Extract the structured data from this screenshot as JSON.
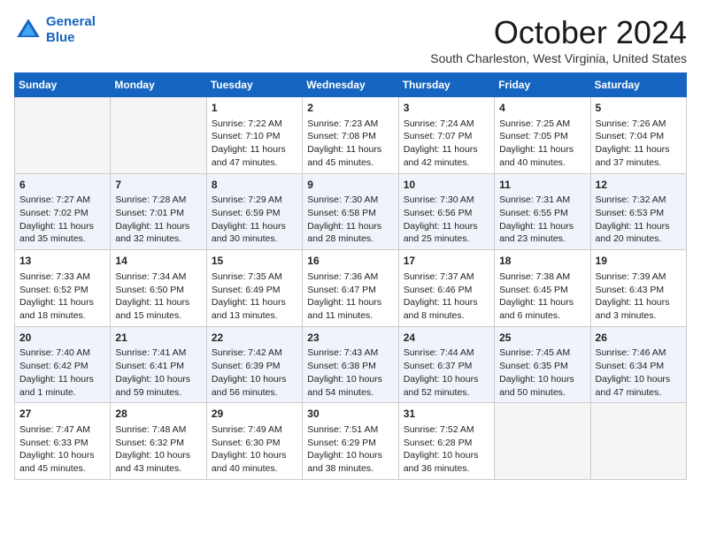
{
  "logo": {
    "line1": "General",
    "line2": "Blue"
  },
  "title": "October 2024",
  "subtitle": "South Charleston, West Virginia, United States",
  "days_of_week": [
    "Sunday",
    "Monday",
    "Tuesday",
    "Wednesday",
    "Thursday",
    "Friday",
    "Saturday"
  ],
  "weeks": [
    [
      {
        "day": "",
        "empty": true
      },
      {
        "day": "",
        "empty": true
      },
      {
        "day": "1",
        "lines": [
          "Sunrise: 7:22 AM",
          "Sunset: 7:10 PM",
          "Daylight: 11 hours and 47 minutes."
        ]
      },
      {
        "day": "2",
        "lines": [
          "Sunrise: 7:23 AM",
          "Sunset: 7:08 PM",
          "Daylight: 11 hours and 45 minutes."
        ]
      },
      {
        "day": "3",
        "lines": [
          "Sunrise: 7:24 AM",
          "Sunset: 7:07 PM",
          "Daylight: 11 hours and 42 minutes."
        ]
      },
      {
        "day": "4",
        "lines": [
          "Sunrise: 7:25 AM",
          "Sunset: 7:05 PM",
          "Daylight: 11 hours and 40 minutes."
        ]
      },
      {
        "day": "5",
        "lines": [
          "Sunrise: 7:26 AM",
          "Sunset: 7:04 PM",
          "Daylight: 11 hours and 37 minutes."
        ]
      }
    ],
    [
      {
        "day": "6",
        "lines": [
          "Sunrise: 7:27 AM",
          "Sunset: 7:02 PM",
          "Daylight: 11 hours and 35 minutes."
        ]
      },
      {
        "day": "7",
        "lines": [
          "Sunrise: 7:28 AM",
          "Sunset: 7:01 PM",
          "Daylight: 11 hours and 32 minutes."
        ]
      },
      {
        "day": "8",
        "lines": [
          "Sunrise: 7:29 AM",
          "Sunset: 6:59 PM",
          "Daylight: 11 hours and 30 minutes."
        ]
      },
      {
        "day": "9",
        "lines": [
          "Sunrise: 7:30 AM",
          "Sunset: 6:58 PM",
          "Daylight: 11 hours and 28 minutes."
        ]
      },
      {
        "day": "10",
        "lines": [
          "Sunrise: 7:30 AM",
          "Sunset: 6:56 PM",
          "Daylight: 11 hours and 25 minutes."
        ]
      },
      {
        "day": "11",
        "lines": [
          "Sunrise: 7:31 AM",
          "Sunset: 6:55 PM",
          "Daylight: 11 hours and 23 minutes."
        ]
      },
      {
        "day": "12",
        "lines": [
          "Sunrise: 7:32 AM",
          "Sunset: 6:53 PM",
          "Daylight: 11 hours and 20 minutes."
        ]
      }
    ],
    [
      {
        "day": "13",
        "lines": [
          "Sunrise: 7:33 AM",
          "Sunset: 6:52 PM",
          "Daylight: 11 hours and 18 minutes."
        ]
      },
      {
        "day": "14",
        "lines": [
          "Sunrise: 7:34 AM",
          "Sunset: 6:50 PM",
          "Daylight: 11 hours and 15 minutes."
        ]
      },
      {
        "day": "15",
        "lines": [
          "Sunrise: 7:35 AM",
          "Sunset: 6:49 PM",
          "Daylight: 11 hours and 13 minutes."
        ]
      },
      {
        "day": "16",
        "lines": [
          "Sunrise: 7:36 AM",
          "Sunset: 6:47 PM",
          "Daylight: 11 hours and 11 minutes."
        ]
      },
      {
        "day": "17",
        "lines": [
          "Sunrise: 7:37 AM",
          "Sunset: 6:46 PM",
          "Daylight: 11 hours and 8 minutes."
        ]
      },
      {
        "day": "18",
        "lines": [
          "Sunrise: 7:38 AM",
          "Sunset: 6:45 PM",
          "Daylight: 11 hours and 6 minutes."
        ]
      },
      {
        "day": "19",
        "lines": [
          "Sunrise: 7:39 AM",
          "Sunset: 6:43 PM",
          "Daylight: 11 hours and 3 minutes."
        ]
      }
    ],
    [
      {
        "day": "20",
        "lines": [
          "Sunrise: 7:40 AM",
          "Sunset: 6:42 PM",
          "Daylight: 11 hours and 1 minute."
        ]
      },
      {
        "day": "21",
        "lines": [
          "Sunrise: 7:41 AM",
          "Sunset: 6:41 PM",
          "Daylight: 10 hours and 59 minutes."
        ]
      },
      {
        "day": "22",
        "lines": [
          "Sunrise: 7:42 AM",
          "Sunset: 6:39 PM",
          "Daylight: 10 hours and 56 minutes."
        ]
      },
      {
        "day": "23",
        "lines": [
          "Sunrise: 7:43 AM",
          "Sunset: 6:38 PM",
          "Daylight: 10 hours and 54 minutes."
        ]
      },
      {
        "day": "24",
        "lines": [
          "Sunrise: 7:44 AM",
          "Sunset: 6:37 PM",
          "Daylight: 10 hours and 52 minutes."
        ]
      },
      {
        "day": "25",
        "lines": [
          "Sunrise: 7:45 AM",
          "Sunset: 6:35 PM",
          "Daylight: 10 hours and 50 minutes."
        ]
      },
      {
        "day": "26",
        "lines": [
          "Sunrise: 7:46 AM",
          "Sunset: 6:34 PM",
          "Daylight: 10 hours and 47 minutes."
        ]
      }
    ],
    [
      {
        "day": "27",
        "lines": [
          "Sunrise: 7:47 AM",
          "Sunset: 6:33 PM",
          "Daylight: 10 hours and 45 minutes."
        ]
      },
      {
        "day": "28",
        "lines": [
          "Sunrise: 7:48 AM",
          "Sunset: 6:32 PM",
          "Daylight: 10 hours and 43 minutes."
        ]
      },
      {
        "day": "29",
        "lines": [
          "Sunrise: 7:49 AM",
          "Sunset: 6:30 PM",
          "Daylight: 10 hours and 40 minutes."
        ]
      },
      {
        "day": "30",
        "lines": [
          "Sunrise: 7:51 AM",
          "Sunset: 6:29 PM",
          "Daylight: 10 hours and 38 minutes."
        ]
      },
      {
        "day": "31",
        "lines": [
          "Sunrise: 7:52 AM",
          "Sunset: 6:28 PM",
          "Daylight: 10 hours and 36 minutes."
        ]
      },
      {
        "day": "",
        "empty": true
      },
      {
        "day": "",
        "empty": true
      }
    ]
  ]
}
